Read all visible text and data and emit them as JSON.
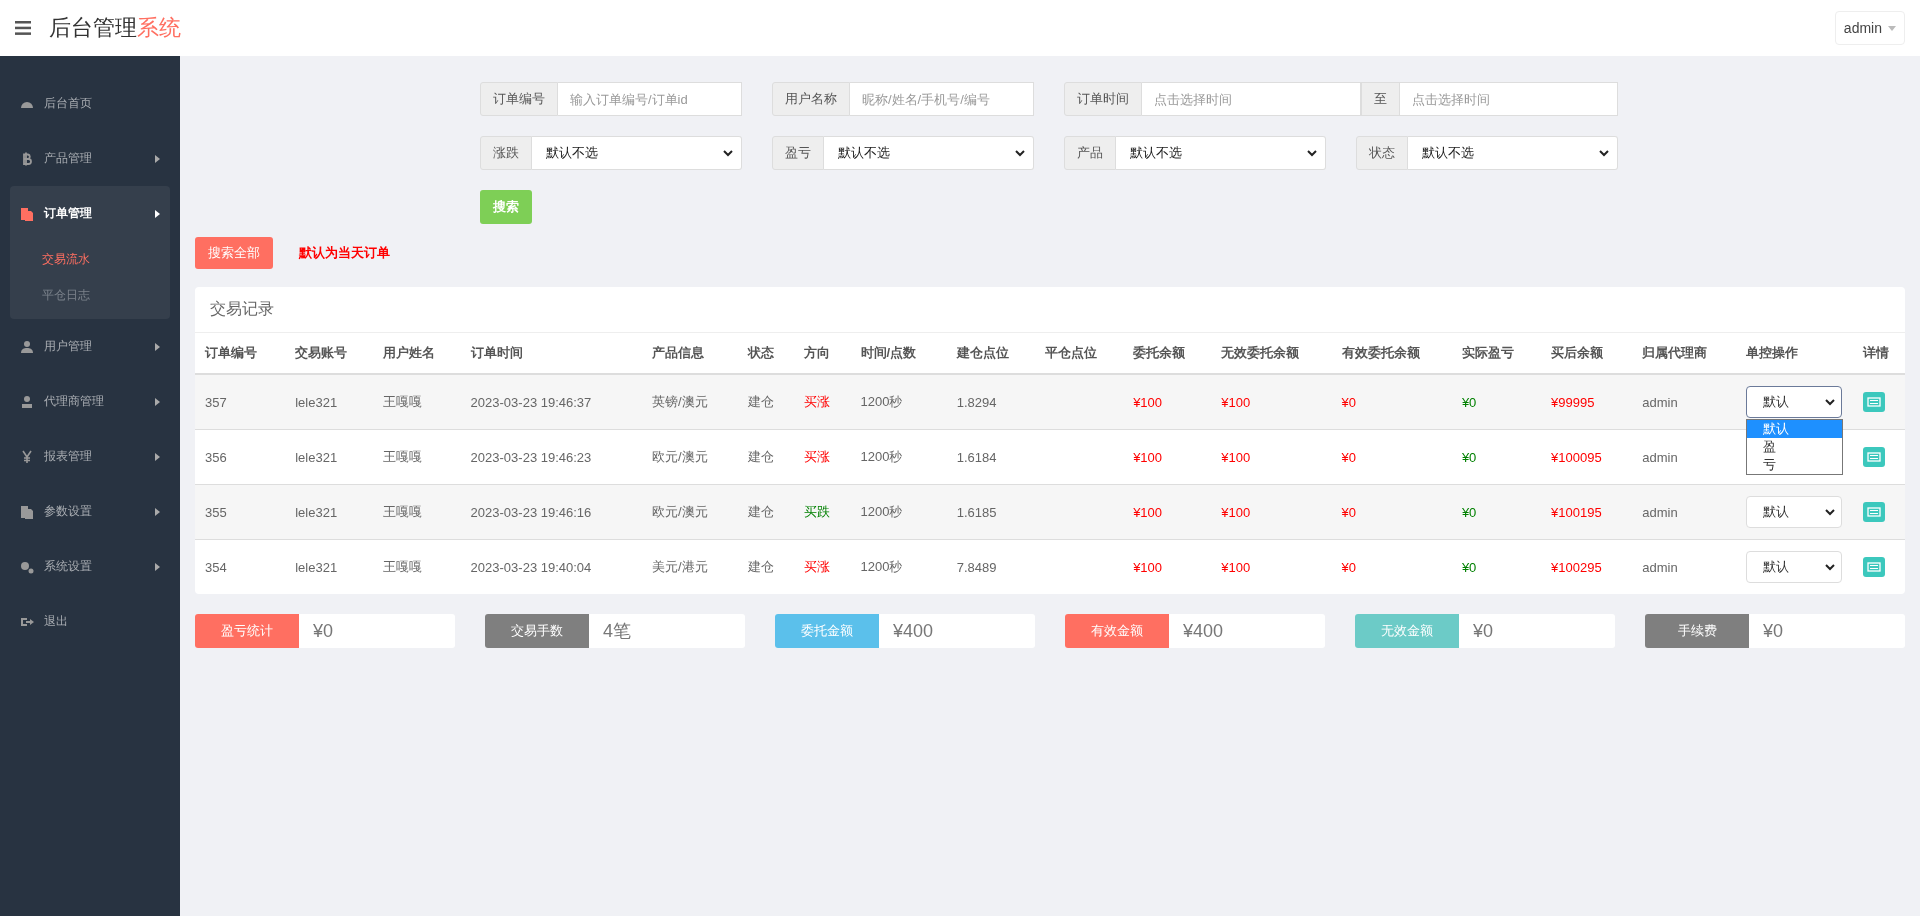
{
  "header": {
    "title": "后台管理",
    "title_accent": "系统",
    "user": "admin"
  },
  "sidebar": {
    "items": [
      {
        "label": "后台首页",
        "expandable": false,
        "expanded": false
      },
      {
        "label": "产品管理",
        "expandable": true,
        "expanded": false
      },
      {
        "label": "订单管理",
        "expandable": true,
        "expanded": true,
        "children": [
          {
            "label": "交易流水",
            "selected": true
          },
          {
            "label": "平仓日志",
            "selected": false
          }
        ]
      },
      {
        "label": "用户管理",
        "expandable": true,
        "expanded": false
      },
      {
        "label": "代理商管理",
        "expandable": true,
        "expanded": false
      },
      {
        "label": "报表管理",
        "expandable": true,
        "expanded": false
      },
      {
        "label": "参数设置",
        "expandable": true,
        "expanded": false
      },
      {
        "label": "系统设置",
        "expandable": true,
        "expanded": false
      },
      {
        "label": "退出",
        "expandable": false,
        "expanded": false
      }
    ]
  },
  "filters": [
    {
      "kind": "text",
      "label": "订单编号",
      "placeholder": "输入订单编号/订单id"
    },
    {
      "kind": "text",
      "label": "用户名称",
      "placeholder": "昵称/姓名/手机号/编号"
    },
    {
      "kind": "range",
      "label": "订单时间",
      "placeholder": "点击选择时间",
      "separator": "至",
      "placeholder_to": "点击选择时间"
    },
    {
      "kind": "select",
      "label": "涨跌",
      "value": "默认不选"
    },
    {
      "kind": "select",
      "label": "盈亏",
      "value": "默认不选"
    },
    {
      "kind": "select",
      "label": "产品",
      "value": "默认不选"
    },
    {
      "kind": "select",
      "label": "状态",
      "value": "默认不选"
    }
  ],
  "search_button": "搜索",
  "search_all_button": "搜索全部",
  "default_note": "默认为当天订单",
  "table": {
    "title": "交易记录",
    "columns": [
      "订单编号",
      "交易账号",
      "用户姓名",
      "订单时间",
      "产品信息",
      "状态",
      "方向",
      "时间/点数",
      "建仓点位",
      "平仓点位",
      "委托余额",
      "无效委托余额",
      "有效委托余额",
      "实际盈亏",
      "买后余额",
      "归属代理商",
      "单控操作",
      "详情"
    ],
    "rows": [
      {
        "cells": [
          "357",
          "lele321",
          "王嘎嘎",
          "2023-03-23 19:46:37",
          "英镑/澳元",
          "建仓"
        ],
        "direction": {
          "text": "买涨",
          "kind": "up"
        },
        "cells2": [
          "1200秒",
          "1.8294"
        ],
        "amounts": [
          "¥100",
          "¥100",
          "¥0",
          "¥0",
          "¥99995"
        ],
        "agent": "admin",
        "control": {
          "value": "默认",
          "expanded": true,
          "options": [
            {
              "label": "默认",
              "selected": true
            },
            {
              "label": "盈",
              "selected": false
            },
            {
              "label": "亏",
              "selected": false
            }
          ]
        }
      },
      {
        "cells": [
          "356",
          "lele321",
          "王嘎嘎",
          "2023-03-23 19:46:23",
          "欧元/澳元",
          "建仓"
        ],
        "direction": {
          "text": "买涨",
          "kind": "up"
        },
        "cells2": [
          "1200秒",
          "1.6184"
        ],
        "amounts": [
          "¥100",
          "¥100",
          "¥0",
          "¥0",
          "¥100095"
        ],
        "agent": "admin"
      },
      {
        "cells": [
          "355",
          "lele321",
          "王嘎嘎",
          "2023-03-23 19:46:16",
          "欧元/澳元",
          "建仓"
        ],
        "direction": {
          "text": "买跌",
          "kind": "down"
        },
        "cells2": [
          "1200秒",
          "1.6185"
        ],
        "amounts": [
          "¥100",
          "¥100",
          "¥0",
          "¥0",
          "¥100195"
        ],
        "agent": "admin",
        "control": {
          "value": "默认",
          "expanded": false
        }
      },
      {
        "cells": [
          "354",
          "lele321",
          "王嘎嘎",
          "2023-03-23 19:40:04",
          "美元/港元",
          "建仓"
        ],
        "direction": {
          "text": "买涨",
          "kind": "up"
        },
        "cells2": [
          "1200秒",
          "7.8489"
        ],
        "amounts": [
          "¥100",
          "¥100",
          "¥0",
          "¥0",
          "¥100295"
        ],
        "agent": "admin",
        "control": {
          "value": "默认",
          "expanded": false
        }
      }
    ]
  },
  "stats": [
    {
      "label": "盈亏统计",
      "value": "¥0",
      "color": "#ff6f61"
    },
    {
      "label": "交易手数",
      "value": "4笔",
      "color": "#7f7f7f"
    },
    {
      "label": "委托金额",
      "value": "¥400",
      "color": "#5bc0eb"
    },
    {
      "label": "有效金额",
      "value": "¥400",
      "color": "#ff6f61"
    },
    {
      "label": "无效金额",
      "value": "¥0",
      "color": "#6ccbc7"
    },
    {
      "label": "手续费",
      "value": "¥0",
      "color": "#7f7f7f"
    }
  ]
}
